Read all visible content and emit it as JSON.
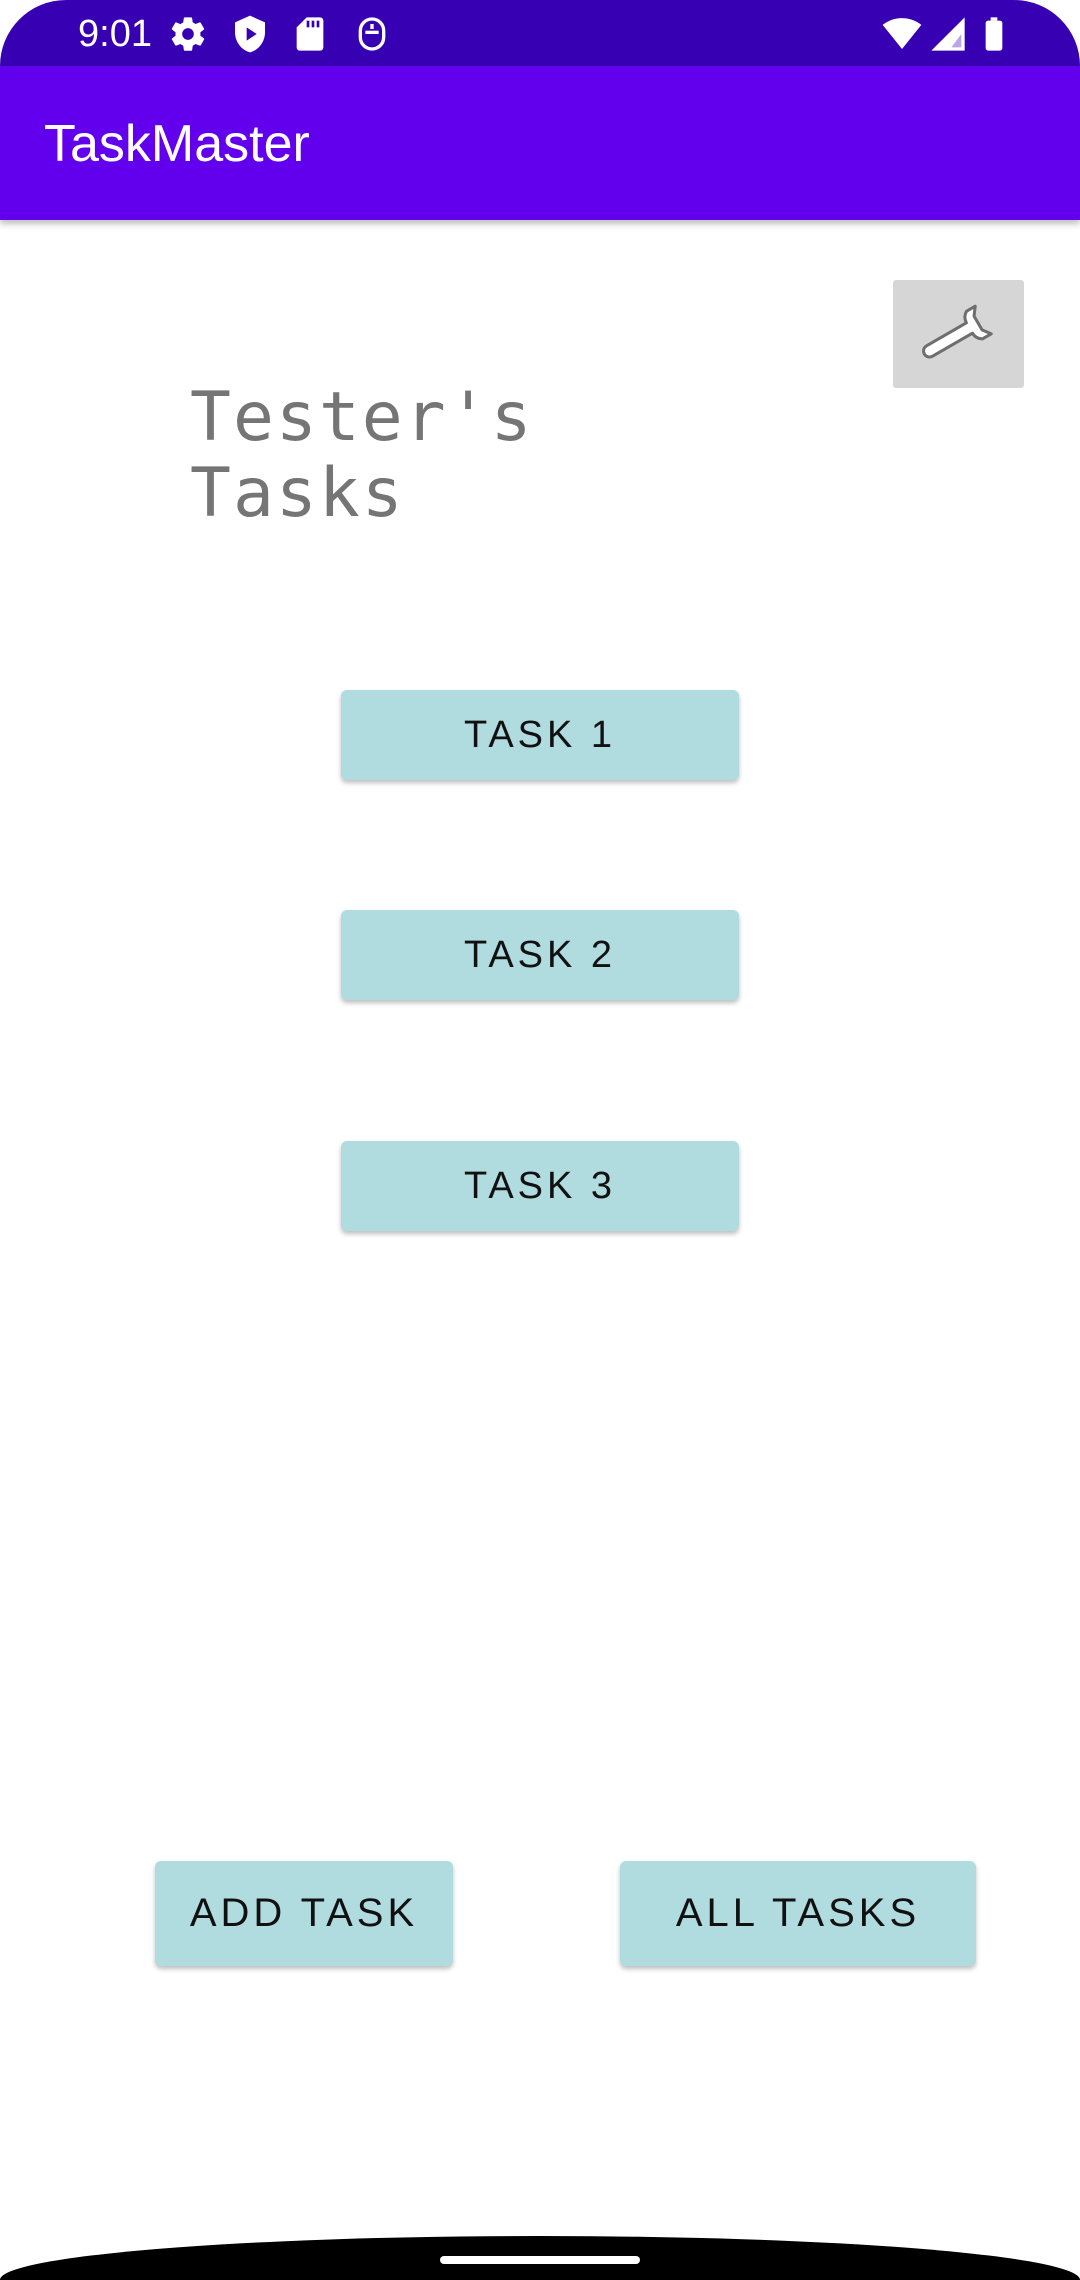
{
  "status_bar": {
    "time": "9:01",
    "left_icons": [
      "settings-icon",
      "shield-play-icon",
      "sd-card-icon",
      "accessibility-icon"
    ],
    "right_icons": [
      "wifi-icon",
      "cell-signal-icon",
      "battery-icon"
    ],
    "background_color": "#3700b3"
  },
  "app_bar": {
    "title": "TaskMaster",
    "background_color": "#6200ee"
  },
  "settings_button": {
    "icon": "wrench-icon"
  },
  "heading": {
    "text": "Tester's\nTasks"
  },
  "tasks": [
    {
      "label": "TASK 1"
    },
    {
      "label": "TASK 2"
    },
    {
      "label": "TASK 3"
    }
  ],
  "bottom_actions": {
    "add_task_label": "ADD TASK",
    "all_tasks_label": "ALL TASKS"
  },
  "colors": {
    "button_background": "#b0dce0",
    "heading_text": "#757575",
    "settings_button_background": "#d6d6d6"
  }
}
